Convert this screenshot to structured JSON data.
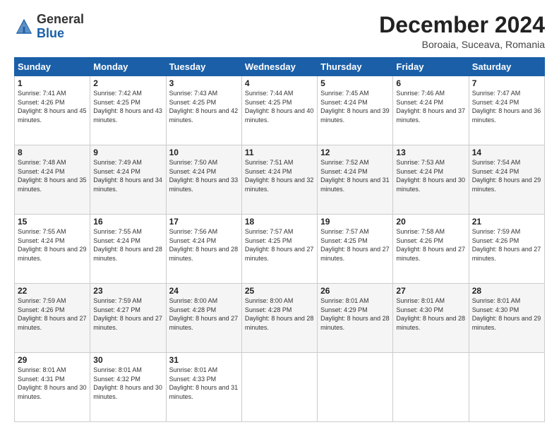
{
  "header": {
    "logo": {
      "general": "General",
      "blue": "Blue"
    },
    "title": "December 2024",
    "location": "Boroaia, Suceava, Romania"
  },
  "calendar": {
    "weekdays": [
      "Sunday",
      "Monday",
      "Tuesday",
      "Wednesday",
      "Thursday",
      "Friday",
      "Saturday"
    ],
    "weeks": [
      [
        {
          "day": "1",
          "sunrise": "7:41 AM",
          "sunset": "4:26 PM",
          "daylight": "8 hours and 45 minutes."
        },
        {
          "day": "2",
          "sunrise": "7:42 AM",
          "sunset": "4:25 PM",
          "daylight": "8 hours and 43 minutes."
        },
        {
          "day": "3",
          "sunrise": "7:43 AM",
          "sunset": "4:25 PM",
          "daylight": "8 hours and 42 minutes."
        },
        {
          "day": "4",
          "sunrise": "7:44 AM",
          "sunset": "4:25 PM",
          "daylight": "8 hours and 40 minutes."
        },
        {
          "day": "5",
          "sunrise": "7:45 AM",
          "sunset": "4:24 PM",
          "daylight": "8 hours and 39 minutes."
        },
        {
          "day": "6",
          "sunrise": "7:46 AM",
          "sunset": "4:24 PM",
          "daylight": "8 hours and 37 minutes."
        },
        {
          "day": "7",
          "sunrise": "7:47 AM",
          "sunset": "4:24 PM",
          "daylight": "8 hours and 36 minutes."
        }
      ],
      [
        {
          "day": "8",
          "sunrise": "7:48 AM",
          "sunset": "4:24 PM",
          "daylight": "8 hours and 35 minutes."
        },
        {
          "day": "9",
          "sunrise": "7:49 AM",
          "sunset": "4:24 PM",
          "daylight": "8 hours and 34 minutes."
        },
        {
          "day": "10",
          "sunrise": "7:50 AM",
          "sunset": "4:24 PM",
          "daylight": "8 hours and 33 minutes."
        },
        {
          "day": "11",
          "sunrise": "7:51 AM",
          "sunset": "4:24 PM",
          "daylight": "8 hours and 32 minutes."
        },
        {
          "day": "12",
          "sunrise": "7:52 AM",
          "sunset": "4:24 PM",
          "daylight": "8 hours and 31 minutes."
        },
        {
          "day": "13",
          "sunrise": "7:53 AM",
          "sunset": "4:24 PM",
          "daylight": "8 hours and 30 minutes."
        },
        {
          "day": "14",
          "sunrise": "7:54 AM",
          "sunset": "4:24 PM",
          "daylight": "8 hours and 29 minutes."
        }
      ],
      [
        {
          "day": "15",
          "sunrise": "7:55 AM",
          "sunset": "4:24 PM",
          "daylight": "8 hours and 29 minutes."
        },
        {
          "day": "16",
          "sunrise": "7:55 AM",
          "sunset": "4:24 PM",
          "daylight": "8 hours and 28 minutes."
        },
        {
          "day": "17",
          "sunrise": "7:56 AM",
          "sunset": "4:24 PM",
          "daylight": "8 hours and 28 minutes."
        },
        {
          "day": "18",
          "sunrise": "7:57 AM",
          "sunset": "4:25 PM",
          "daylight": "8 hours and 27 minutes."
        },
        {
          "day": "19",
          "sunrise": "7:57 AM",
          "sunset": "4:25 PM",
          "daylight": "8 hours and 27 minutes."
        },
        {
          "day": "20",
          "sunrise": "7:58 AM",
          "sunset": "4:26 PM",
          "daylight": "8 hours and 27 minutes."
        },
        {
          "day": "21",
          "sunrise": "7:59 AM",
          "sunset": "4:26 PM",
          "daylight": "8 hours and 27 minutes."
        }
      ],
      [
        {
          "day": "22",
          "sunrise": "7:59 AM",
          "sunset": "4:26 PM",
          "daylight": "8 hours and 27 minutes."
        },
        {
          "day": "23",
          "sunrise": "7:59 AM",
          "sunset": "4:27 PM",
          "daylight": "8 hours and 27 minutes."
        },
        {
          "day": "24",
          "sunrise": "8:00 AM",
          "sunset": "4:28 PM",
          "daylight": "8 hours and 27 minutes."
        },
        {
          "day": "25",
          "sunrise": "8:00 AM",
          "sunset": "4:28 PM",
          "daylight": "8 hours and 28 minutes."
        },
        {
          "day": "26",
          "sunrise": "8:01 AM",
          "sunset": "4:29 PM",
          "daylight": "8 hours and 28 minutes."
        },
        {
          "day": "27",
          "sunrise": "8:01 AM",
          "sunset": "4:30 PM",
          "daylight": "8 hours and 28 minutes."
        },
        {
          "day": "28",
          "sunrise": "8:01 AM",
          "sunset": "4:30 PM",
          "daylight": "8 hours and 29 minutes."
        }
      ],
      [
        {
          "day": "29",
          "sunrise": "8:01 AM",
          "sunset": "4:31 PM",
          "daylight": "8 hours and 30 minutes."
        },
        {
          "day": "30",
          "sunrise": "8:01 AM",
          "sunset": "4:32 PM",
          "daylight": "8 hours and 30 minutes."
        },
        {
          "day": "31",
          "sunrise": "8:01 AM",
          "sunset": "4:33 PM",
          "daylight": "8 hours and 31 minutes."
        },
        null,
        null,
        null,
        null
      ]
    ]
  }
}
